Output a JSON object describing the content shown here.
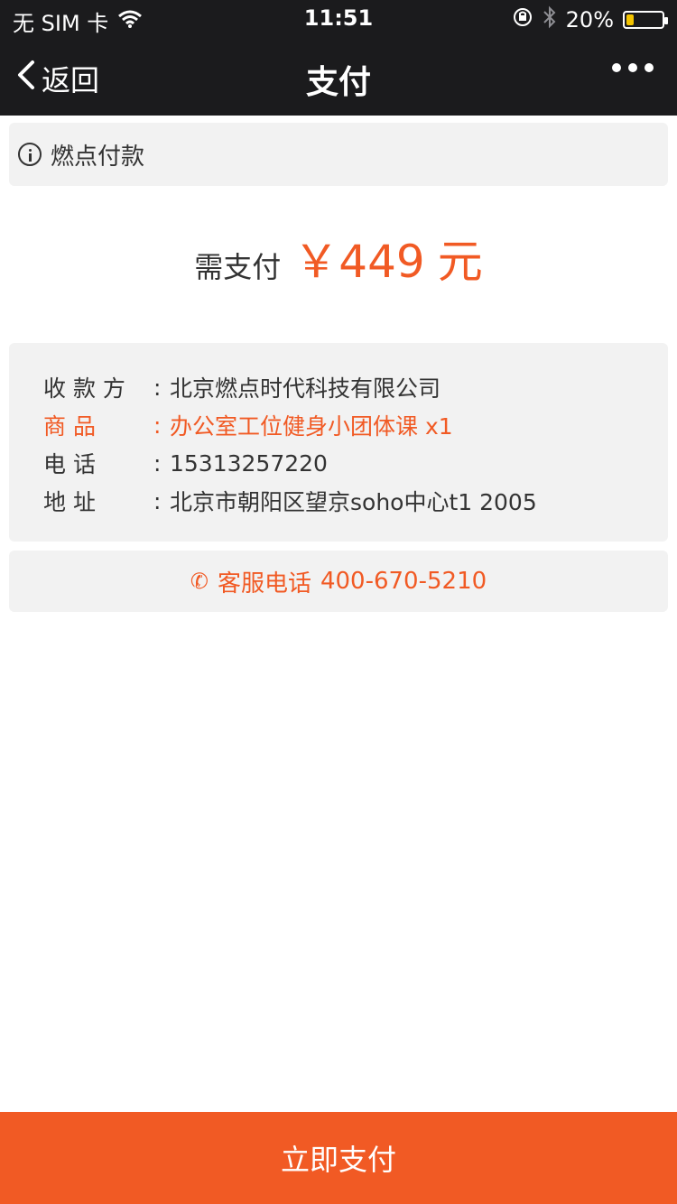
{
  "status_bar": {
    "carrier": "无 SIM 卡",
    "time": "11:51",
    "battery": "20%",
    "battery_level": 0.2,
    "icons": [
      "wifi-icon",
      "lock-rotation-icon",
      "bluetooth-icon",
      "battery-icon"
    ]
  },
  "nav": {
    "back_label": "返回",
    "title": "支付",
    "more_icon": "more-icon"
  },
  "notice": {
    "text": "燃点付款",
    "icon": "info-icon"
  },
  "amount": {
    "label": "需支付",
    "value": "￥449",
    "unit": "元"
  },
  "details": {
    "payee": {
      "label": "收 款 方",
      "value": "北京燃点时代科技有限公司"
    },
    "goods": {
      "label": "商     品",
      "value": "办公室工位健身小团体课   x1"
    },
    "phone": {
      "label": "电     话",
      "value": "15313257220"
    },
    "address": {
      "label": "地     址",
      "value": "北京市朝阳区望京soho中心t1 2005"
    }
  },
  "service": {
    "label": "客服电话",
    "number": "400-670-5210",
    "icon": "phone-icon"
  },
  "pay_button": {
    "label": "立即支付"
  },
  "colors": {
    "accent": "#f15a24",
    "nav_bg": "#1b1b1d",
    "card_bg": "#f2f2f2"
  }
}
